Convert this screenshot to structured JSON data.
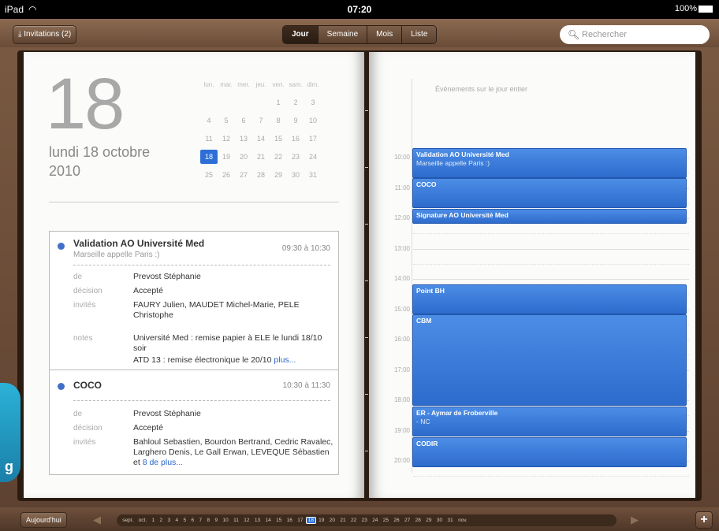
{
  "status": {
    "carrier": "iPad",
    "time": "07:20",
    "battery": "100%"
  },
  "toolbar": {
    "invitations": "Invitations (2)",
    "views": [
      "Jour",
      "Semaine",
      "Mois",
      "Liste"
    ],
    "selected_view": "Jour",
    "search_placeholder": "Rechercher"
  },
  "day": {
    "number": "18",
    "line1": "lundi 18 octobre",
    "line2": "2010"
  },
  "minical": {
    "headers": [
      "lun.",
      "mar.",
      "mer.",
      "jeu.",
      "ven.",
      "sam.",
      "dim."
    ],
    "weeks": [
      [
        "",
        "",
        "",
        "",
        "1",
        "2",
        "3"
      ],
      [
        "4",
        "5",
        "6",
        "7",
        "8",
        "9",
        "10"
      ],
      [
        "11",
        "12",
        "13",
        "14",
        "15",
        "16",
        "17"
      ],
      [
        "18",
        "19",
        "20",
        "21",
        "22",
        "23",
        "24"
      ],
      [
        "25",
        "26",
        "27",
        "28",
        "29",
        "30",
        "31"
      ]
    ],
    "today": "18"
  },
  "events": [
    {
      "title": "Validation AO Université Med",
      "subtitle": "Marseille appelle Paris :)",
      "time": "09:30 à 10:30",
      "labels": {
        "de": "de",
        "decision": "décision",
        "invites": "invités",
        "notes": "notes"
      },
      "de": "Prevost Stéphanie",
      "decision": "Accepté",
      "invites": "FAURY Julien, MAUDET Michel-Marie, PELE Christophe",
      "notes": "Université Med : remise papier à ELE le lundi 18/10 soir",
      "notes2": "ATD 13 : remise électronique le 20/10",
      "more": "plus..."
    },
    {
      "title": "COCO",
      "time": "10:30 à 11:30",
      "labels": {
        "de": "de",
        "decision": "décision",
        "invites": "invités"
      },
      "de": "Prevost Stéphanie",
      "decision": "Accepté",
      "invites": "Bahloul Sebastien, Bourdon Bertrand, Cedric Ravalec, Larghero Denis, Le Gall Erwan, LEVEQUE Sébastien et",
      "more": "8 de plus..."
    }
  ],
  "right": {
    "header": "Événements sur le jour entier",
    "hours": [
      "10:00",
      "11:00",
      "12:00",
      "13:00",
      "14:00",
      "15:00",
      "16:00",
      "17:00",
      "18:00",
      "19:00",
      "20:00"
    ],
    "blocks": [
      {
        "title": "Validation AO Université Med",
        "sub": "Marseille appelle Paris :)"
      },
      {
        "title": "COCO",
        "sub": ""
      },
      {
        "title": "Signature AO Université Med",
        "sub": ""
      },
      {
        "title": "Point BH",
        "sub": ""
      },
      {
        "title": "CBM",
        "sub": ""
      },
      {
        "title": "ER - Aymar de Froberville",
        "sub": "- NC"
      },
      {
        "title": "CODIR",
        "sub": ""
      }
    ]
  },
  "bottom": {
    "today": "Aujourd'hui",
    "prev_month": "sept.",
    "month": "oct.",
    "next_month": "nov.",
    "days": [
      "1",
      "2",
      "3",
      "4",
      "5",
      "6",
      "7",
      "8",
      "9",
      "10",
      "11",
      "12",
      "13",
      "14",
      "15",
      "16",
      "17",
      "18",
      "19",
      "20",
      "21",
      "22",
      "23",
      "24",
      "25",
      "26",
      "27",
      "28",
      "29",
      "30",
      "31"
    ],
    "selected": "18"
  },
  "colors": {
    "accent": "#2d6fd6",
    "event_blue": "#3a7ad8",
    "leather": "#6a4c38"
  }
}
